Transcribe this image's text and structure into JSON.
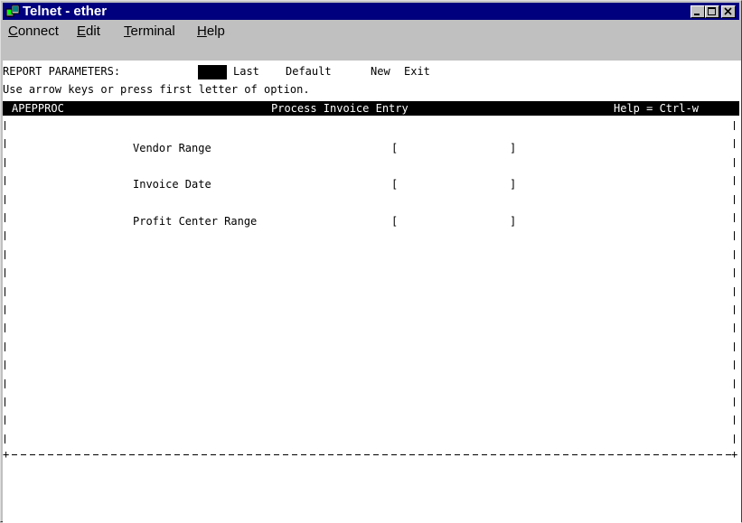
{
  "window": {
    "title": "Telnet - ether",
    "controls": {
      "minimize": "minimize-icon",
      "maximize": "maximize-icon",
      "close": "close-icon"
    }
  },
  "menu": [
    {
      "mnemonic": "C",
      "rest": "onnect"
    },
    {
      "mnemonic": "E",
      "rest": "dit"
    },
    {
      "mnemonic": "T",
      "rest": "erminal"
    },
    {
      "mnemonic": "H",
      "rest": "elp"
    }
  ],
  "terminal": {
    "prompt_label": "REPORT PARAMETERS:",
    "options": [
      "Last",
      "Default",
      "New",
      "Exit"
    ],
    "instruction": "Use arrow keys or press first letter of option.",
    "header": {
      "program": "APEPPROC",
      "screen_title": "Process Invoice Entry",
      "help": "Help = Ctrl-w"
    },
    "fields": [
      {
        "label": "Vendor Range",
        "open": "[",
        "value": "",
        "close": "]"
      },
      {
        "label": "Invoice Date",
        "open": "[",
        "value": "",
        "close": "]"
      },
      {
        "label": "Profit Center Range",
        "open": "[",
        "value": "",
        "close": "]"
      }
    ],
    "bottom_corner_left": "+",
    "bottom_corner_right": "+"
  },
  "colors": {
    "titlebar": "#00007e",
    "chrome": "#c0c0c0",
    "terminal_bg": "#ffffff",
    "terminal_fg": "#000000"
  }
}
